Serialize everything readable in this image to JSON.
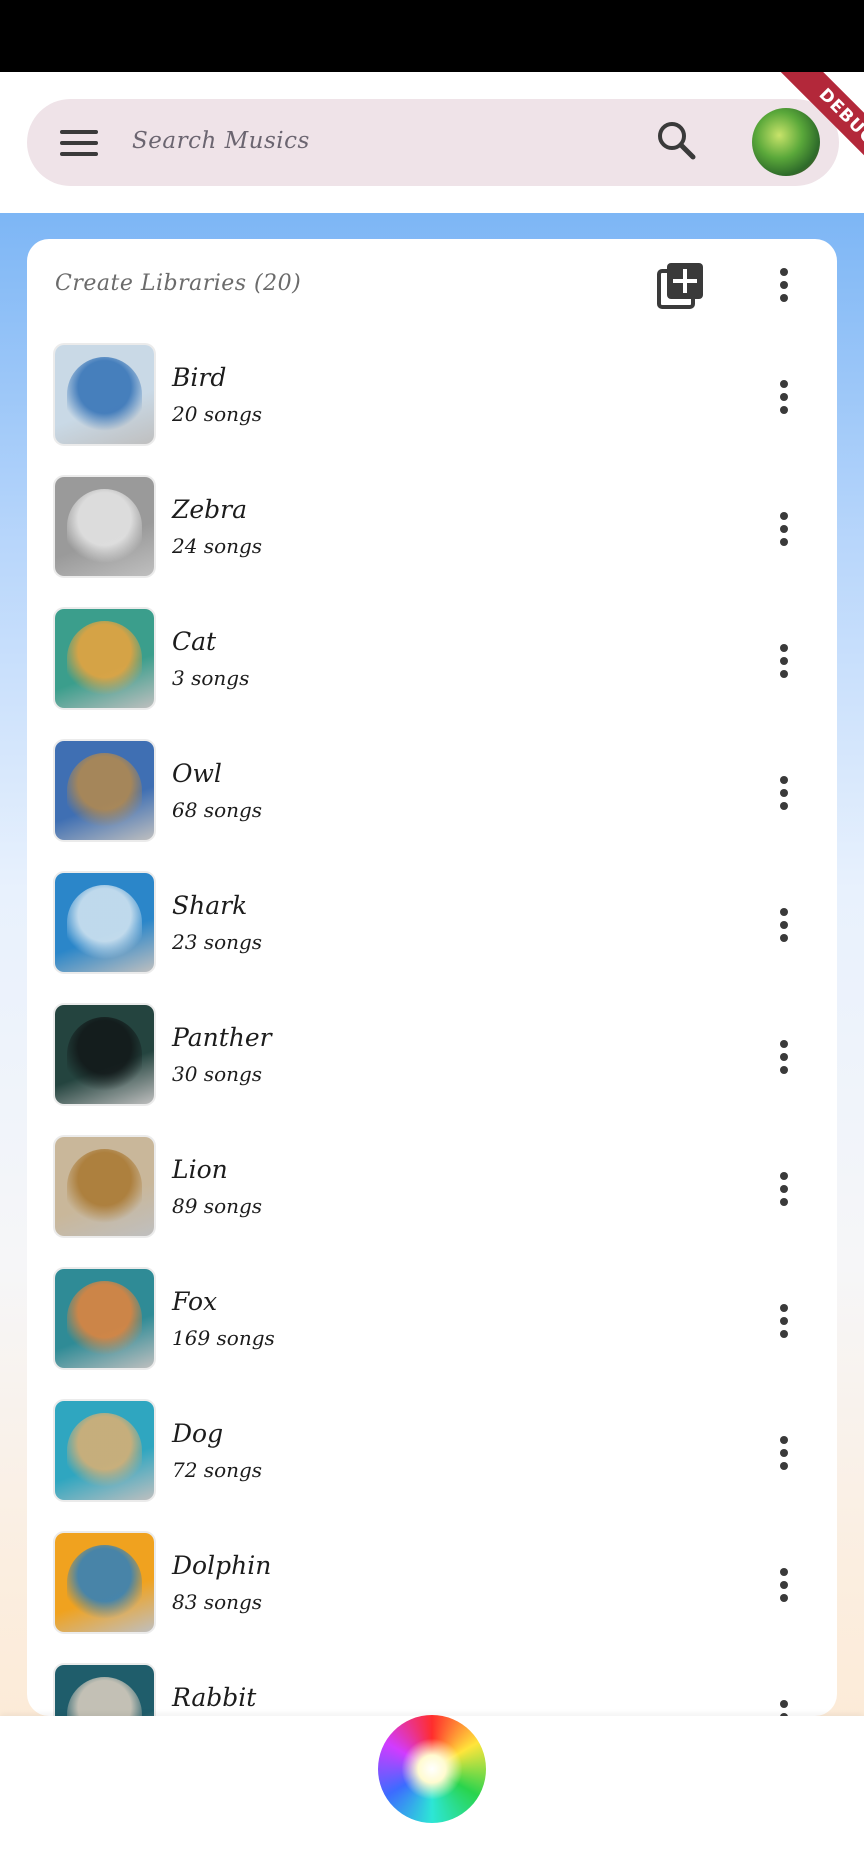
{
  "search": {
    "placeholder": "Search Musics"
  },
  "debug_banner": "DEBUG",
  "library": {
    "title": "Create Libraries (20)",
    "items": [
      {
        "name": "Bird",
        "count": "20 songs",
        "color": "#c9d9e6",
        "accent": "#2f6fb5"
      },
      {
        "name": "Zebra",
        "count": "24 songs",
        "color": "#9a9a9a",
        "accent": "#e8e8e8"
      },
      {
        "name": "Cat",
        "count": "3 songs",
        "color": "#3b9e8c",
        "accent": "#f0a43a"
      },
      {
        "name": "Owl",
        "count": "68 songs",
        "color": "#3f6fb3",
        "accent": "#b78a4a"
      },
      {
        "name": "Shark",
        "count": "23 songs",
        "color": "#2b86c9",
        "accent": "#d9e8f2"
      },
      {
        "name": "Panther",
        "count": "30 songs",
        "color": "#24443f",
        "accent": "#111617"
      },
      {
        "name": "Lion",
        "count": "89 songs",
        "color": "#c9b79a",
        "accent": "#a8762e"
      },
      {
        "name": "Fox",
        "count": "169 songs",
        "color": "#2f8b96",
        "accent": "#e8843a"
      },
      {
        "name": "Dog",
        "count": "72 songs",
        "color": "#2fa6c0",
        "accent": "#e0b070"
      },
      {
        "name": "Dolphin",
        "count": "83 songs",
        "color": "#f0a21f",
        "accent": "#2a7fc0"
      },
      {
        "name": "Rabbit",
        "count": "",
        "color": "#1f5d6b",
        "accent": "#e0d2c2"
      }
    ]
  }
}
